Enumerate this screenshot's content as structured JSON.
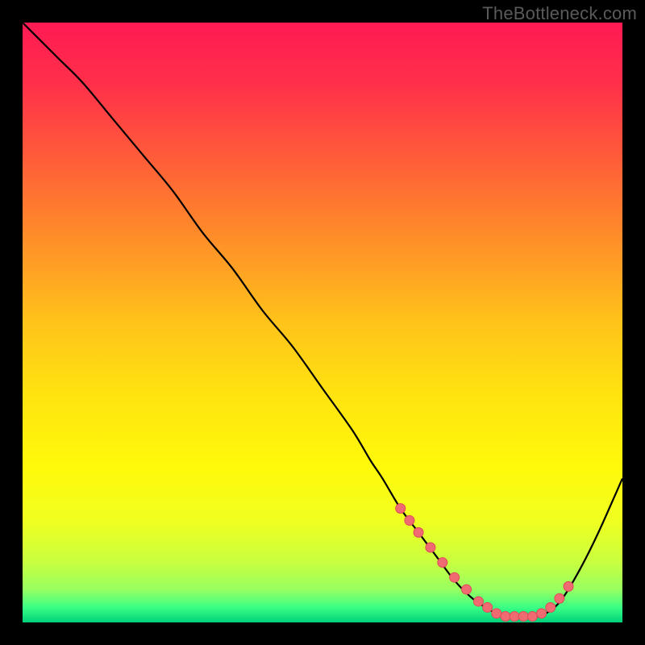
{
  "watermark": "TheBottleneck.com",
  "colors": {
    "background": "#000000",
    "gradient_stops": [
      {
        "offset": 0.0,
        "color": "#ff1a53"
      },
      {
        "offset": 0.1,
        "color": "#ff2f4a"
      },
      {
        "offset": 0.22,
        "color": "#ff5a3a"
      },
      {
        "offset": 0.35,
        "color": "#ff8a2a"
      },
      {
        "offset": 0.5,
        "color": "#ffc31a"
      },
      {
        "offset": 0.62,
        "color": "#ffe310"
      },
      {
        "offset": 0.74,
        "color": "#fff90a"
      },
      {
        "offset": 0.83,
        "color": "#f0ff20"
      },
      {
        "offset": 0.9,
        "color": "#c8ff40"
      },
      {
        "offset": 0.945,
        "color": "#98ff60"
      },
      {
        "offset": 0.975,
        "color": "#3aff85"
      },
      {
        "offset": 1.0,
        "color": "#00d07a"
      }
    ],
    "curve": "#000000",
    "marker_fill": "#f06a72",
    "marker_stroke": "#e04a58"
  },
  "chart_data": {
    "type": "line",
    "title": "",
    "xlabel": "",
    "ylabel": "",
    "xlim": [
      0,
      100
    ],
    "ylim": [
      0,
      100
    ],
    "series": [
      {
        "name": "bottleneck-curve",
        "x": [
          0,
          3,
          6,
          10,
          15,
          20,
          25,
          30,
          35,
          40,
          45,
          50,
          55,
          58,
          60,
          63,
          66,
          69,
          72,
          75,
          78,
          80,
          82,
          84,
          86,
          88,
          90,
          93,
          96,
          100
        ],
        "y": [
          100,
          97,
          94,
          90,
          84,
          78,
          72,
          65,
          59,
          52,
          46,
          39,
          32,
          27,
          24,
          19,
          15,
          11,
          7,
          4,
          2,
          1,
          1,
          1,
          1,
          2,
          4,
          9,
          15,
          24
        ]
      }
    ],
    "markers": {
      "name": "highlight-points",
      "x": [
        63.0,
        64.5,
        66.0,
        68.0,
        70.0,
        72.0,
        74.0,
        76.0,
        77.5,
        79.0,
        80.5,
        82.0,
        83.5,
        85.0,
        86.5,
        88.0,
        89.5,
        91.0
      ],
      "y": [
        19.0,
        17.0,
        15.0,
        12.5,
        10.0,
        7.5,
        5.5,
        3.5,
        2.5,
        1.5,
        1.0,
        1.0,
        1.0,
        1.0,
        1.5,
        2.5,
        4.0,
        6.0
      ]
    }
  }
}
